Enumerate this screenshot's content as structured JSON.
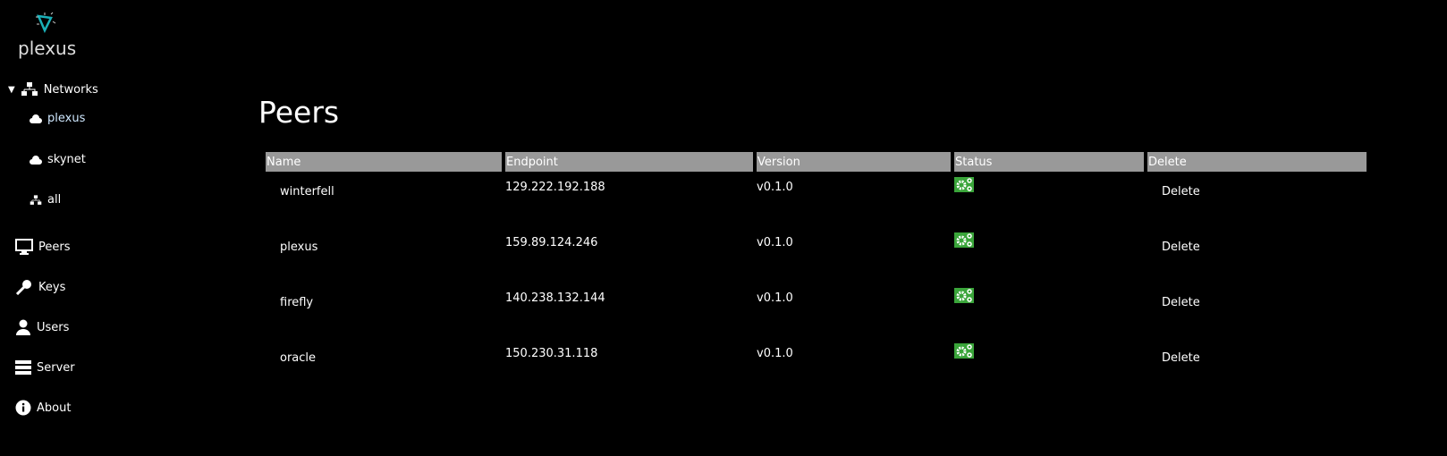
{
  "brand": {
    "name": "plexus"
  },
  "sidebar": {
    "networks_label": "Networks",
    "networks": [
      {
        "label": "plexus",
        "icon": "cloud-icon",
        "color": "#cfe8ff"
      },
      {
        "label": "skynet",
        "icon": "cloud-icon"
      },
      {
        "label": "all",
        "icon": "network-icon"
      }
    ],
    "items": [
      {
        "label": "Peers",
        "icon": "monitor-icon"
      },
      {
        "label": "Keys",
        "icon": "key-icon"
      },
      {
        "label": "Users",
        "icon": "user-icon"
      },
      {
        "label": "Server",
        "icon": "server-icon"
      },
      {
        "label": "About",
        "icon": "info-icon"
      }
    ]
  },
  "main": {
    "title": "Peers",
    "columns": [
      "Name",
      "Endpoint",
      "Version",
      "Status",
      "Delete"
    ],
    "rows": [
      {
        "name": "winterfell",
        "endpoint": "129.222.192.188",
        "version": "v0.1.0",
        "status": "online",
        "delete": "Delete"
      },
      {
        "name": "plexus",
        "endpoint": "159.89.124.246",
        "version": "v0.1.0",
        "status": "online",
        "delete": "Delete"
      },
      {
        "name": "firefly",
        "endpoint": "140.238.132.144",
        "version": "v0.1.0",
        "status": "online",
        "delete": "Delete"
      },
      {
        "name": "oracle",
        "endpoint": "150.230.31.118",
        "version": "v0.1.0",
        "status": "online",
        "delete": "Delete"
      }
    ]
  },
  "colors": {
    "status_online": "#3aa53a",
    "header_bg": "#999999"
  }
}
